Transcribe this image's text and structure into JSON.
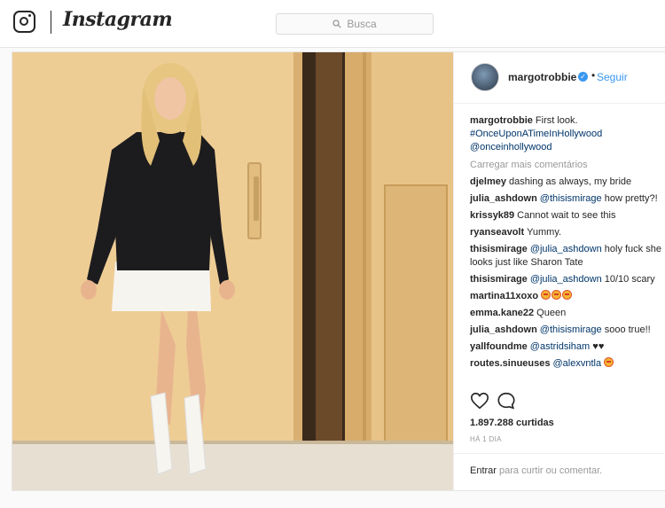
{
  "header": {
    "brand": "Instagram",
    "search_placeholder": "Busca"
  },
  "post": {
    "username": "margotrobbie",
    "follow_label": "Seguir",
    "separator": "•",
    "caption": {
      "username": "margotrobbie",
      "text": "First look.",
      "hashtag": "#OnceUponATimeInHollywood",
      "mention": "@onceinhollywood"
    },
    "load_more": "Carregar mais comentários",
    "comments": [
      {
        "user": "djelmey",
        "mention": "",
        "text": "dashing as always, my bride",
        "emoji": ""
      },
      {
        "user": "julia_ashdown",
        "mention": "@thisismirage",
        "text": "how pretty?!",
        "emoji": ""
      },
      {
        "user": "krissyk89",
        "mention": "",
        "text": "Cannot wait to see this",
        "emoji": ""
      },
      {
        "user": "ryanseavolt",
        "mention": "",
        "text": "Yummy.",
        "emoji": ""
      },
      {
        "user": "thisismirage",
        "mention": "@julia_ashdown",
        "text": "holy fuck she looks just like Sharon Tate",
        "emoji": ""
      },
      {
        "user": "thisismirage",
        "mention": "@julia_ashdown",
        "text": "10/10 scary",
        "emoji": ""
      },
      {
        "user": "martina11xoxo",
        "mention": "",
        "text": "",
        "emoji": "heart-eyes x3"
      },
      {
        "user": "emma.kane22",
        "mention": "",
        "text": "Queen",
        "emoji": ""
      },
      {
        "user": "julia_ashdown",
        "mention": "@thisismirage",
        "text": "sooo true!!",
        "emoji": ""
      },
      {
        "user": "yallfoundme",
        "mention": "@astridsiham",
        "text": "♥♥",
        "emoji": ""
      },
      {
        "user": "routes.sinueuses",
        "mention": "@alexvntla",
        "text": "",
        "emoji": "heart-eyes"
      }
    ],
    "likes": "1.897.288 curtidas",
    "time": "HÁ 1 DIA",
    "login_link": "Entrar",
    "login_suffix": "para curtir ou comentar."
  },
  "icons": {
    "header": [
      "instagram-logo-icon",
      "search-icon"
    ],
    "actions": [
      "heart-icon",
      "comment-icon"
    ],
    "badge": "verified-badge-icon"
  },
  "colors": {
    "link_blue": "#3897f0",
    "hashtag_blue": "#003569",
    "muted_gray": "#999999",
    "text": "#262626",
    "photo_wall": "#e9c78c"
  }
}
